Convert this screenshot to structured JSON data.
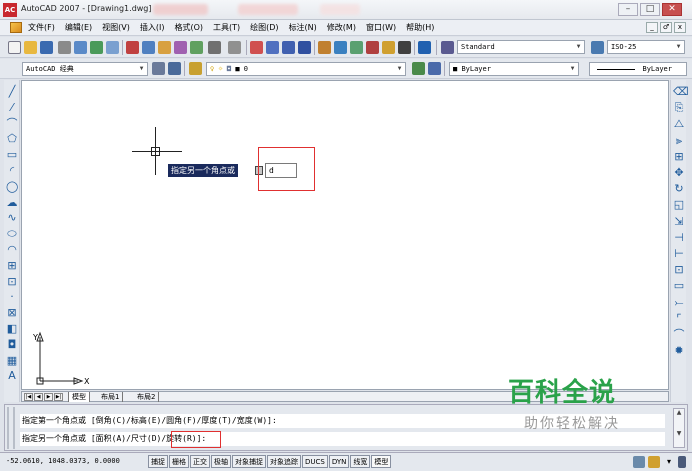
{
  "window": {
    "title": "AutoCAD 2007 - [Drawing1.dwg]",
    "app_icon_label": "AC",
    "minimize": "–",
    "maximize": "□",
    "close": "✕"
  },
  "menubar": {
    "items": [
      "文件(F)",
      "编辑(E)",
      "视图(V)",
      "插入(I)",
      "格式(O)",
      "工具(T)",
      "绘图(D)",
      "标注(N)",
      "修改(M)",
      "窗口(W)",
      "帮助(H)"
    ],
    "mdi_buttons": [
      "_",
      "♂",
      "x"
    ]
  },
  "toolbar1": {
    "text_style": "Standard",
    "dim_style": "ISO-25"
  },
  "toolbar2": {
    "workspace": "AutoCAD 经典",
    "layer": "0",
    "color": "ByLayer",
    "linetype": "ByLayer"
  },
  "canvas": {
    "tooltip": "指定另一个角点或",
    "input_value": "d",
    "ucs_x": "X",
    "ucs_y": "Y"
  },
  "tabs": {
    "nav": [
      "|◀",
      "◀",
      "▶",
      "▶|"
    ],
    "items": [
      "模型",
      "布局1",
      "布局2"
    ]
  },
  "command": {
    "line1": "指定第一个角点或 [倒角(C)/标高(E)/圆角(F)/厚度(T)/宽度(W)]:",
    "line2": "指定另一个角点或 [面积(A)/尺寸(D)/旋转(R)]:"
  },
  "watermark": {
    "title": "百科全说",
    "subtitle": "助你轻松解决"
  },
  "statusbar": {
    "coords": "-52.0610,  1048.0373, 0.0000",
    "toggles": [
      "捕捉",
      "栅格",
      "正交",
      "极轴",
      "对象捕捉",
      "对象追踪",
      "DUCS",
      "DYN",
      "线宽",
      "模型"
    ]
  },
  "colors": {
    "tooltip_bg": "#1a2a5c",
    "highlight": "#e03030",
    "watermark_green": "#2aa24a"
  },
  "left_tools": [
    "line-icon",
    "construction-line-icon",
    "polyline-icon",
    "polygon-icon",
    "rectangle-icon",
    "arc-icon",
    "circle-icon",
    "revision-cloud-icon",
    "spline-icon",
    "ellipse-icon",
    "ellipse-arc-icon",
    "insert-block-icon",
    "make-block-icon",
    "point-icon",
    "hatch-icon",
    "gradient-icon",
    "region-icon",
    "table-icon",
    "multiline-text-icon"
  ],
  "right_tools": [
    "erase-icon",
    "copy-icon",
    "mirror-icon",
    "offset-icon",
    "array-icon",
    "move-icon",
    "rotate-icon",
    "scale-icon",
    "stretch-icon",
    "trim-icon",
    "extend-icon",
    "break-at-point-icon",
    "break-icon",
    "join-icon",
    "chamfer-icon",
    "fillet-icon",
    "explode-icon"
  ]
}
